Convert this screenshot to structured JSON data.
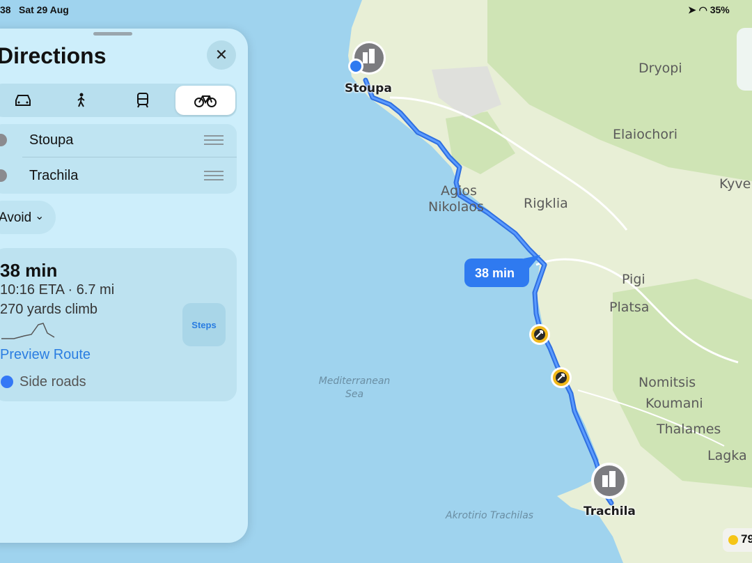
{
  "status_bar": {
    "time": "38",
    "date": "Sat 29 Aug",
    "battery": "35%"
  },
  "panel": {
    "title": "Directions",
    "close_glyph": "✕",
    "modes": [
      {
        "name": "car-icon",
        "selected": false
      },
      {
        "name": "walk-icon",
        "selected": false
      },
      {
        "name": "transit-icon",
        "selected": false
      },
      {
        "name": "bicycle-icon",
        "selected": true
      }
    ],
    "stops": [
      "Stoupa",
      "Trachila"
    ],
    "avoid_label": "Avoid",
    "route": {
      "duration": "38 min",
      "eta_distance": "10:16 ETA · 6.7 mi",
      "climb": "270 yards climb",
      "steps_label": "Steps",
      "preview_label": "Preview Route",
      "road_type": "Side roads"
    }
  },
  "map": {
    "callout": "38 min",
    "places": [
      "Dryopi",
      "Elaiochori",
      "Agios",
      "Nikolaos",
      "Rigklia",
      "Kyve",
      "Pigi",
      "Platsa",
      "Nomitsis",
      "Koumani",
      "Thalames",
      "Lagka"
    ],
    "sea_label_1": "Mediterranean",
    "sea_label_2": "Sea",
    "cape": "Akrotirio Trachilas",
    "start_pin": "Stoupa",
    "end_pin": "Trachila",
    "weather_temp": "79",
    "colors": {
      "route": "#3478f6",
      "land": "#e8efd6",
      "forest": "#cfe4b5",
      "sea": "#9fd3ee"
    }
  }
}
